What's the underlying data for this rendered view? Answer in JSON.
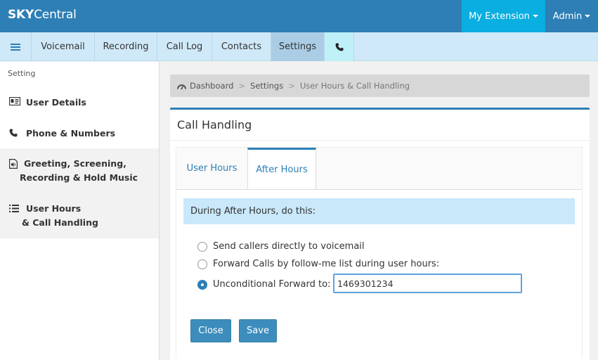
{
  "brand": {
    "bold": "SKY",
    "light": "Central"
  },
  "topbar": {
    "my_extension": "My Extension",
    "admin": "Admin"
  },
  "nav": {
    "menu_icon": "hamburger-menu-icon",
    "items": [
      {
        "label": "Voicemail"
      },
      {
        "label": "Recording"
      },
      {
        "label": "Call Log"
      },
      {
        "label": "Contacts"
      },
      {
        "label": "Settings",
        "active": true
      }
    ],
    "phone_icon": "phone-icon"
  },
  "sidebar": {
    "heading": "Setting",
    "items": [
      {
        "icon": "id-card-icon",
        "line1": "User Details",
        "line2": ""
      },
      {
        "icon": "phone-icon",
        "line1": "Phone & Numbers",
        "line2": ""
      },
      {
        "icon": "audio-file-icon",
        "line1": "Greeting, Screening,",
        "line2": "Recording & Hold Music"
      },
      {
        "icon": "list-icon",
        "line1": "User Hours",
        "line2": "& Call Handling"
      }
    ]
  },
  "breadcrumb": {
    "home": "Dashboard",
    "mid": "Settings",
    "current": "User Hours & Call Handling"
  },
  "panel": {
    "title": "Call Handling",
    "tabs": [
      {
        "label": "User Hours"
      },
      {
        "label": "After Hours",
        "active": true
      }
    ],
    "info": "During After Hours, do this:",
    "options": [
      {
        "label": "Send callers directly to voicemail",
        "checked": false
      },
      {
        "label": "Forward Calls by follow-me list during user hours:",
        "checked": false
      },
      {
        "label": "Unconditional Forward to:",
        "checked": true
      }
    ],
    "forward_value": "1469301234",
    "close_label": "Close",
    "save_label": "Save"
  },
  "colors": {
    "primary": "#2d7fb5",
    "accent": "#0aaee0",
    "nav_bg": "#d0e9f9",
    "info_bg": "#c9e8fa"
  }
}
